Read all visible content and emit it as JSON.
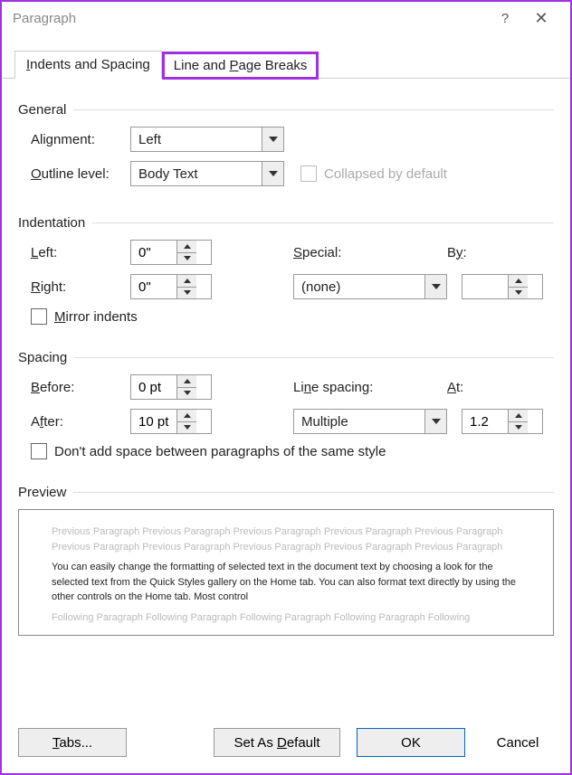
{
  "title": "Paragraph",
  "tabs": {
    "indents": "Indents and Spacing",
    "breaks": "Line and Page Breaks"
  },
  "general": {
    "header": "General",
    "alignment_label": "Alignment:",
    "alignment_value": "Left",
    "outline_label": "Outline level:",
    "outline_value": "Body Text",
    "collapsed_label": "Collapsed by default"
  },
  "indentation": {
    "header": "Indentation",
    "left_label": "Left:",
    "left_value": "0\"",
    "right_label": "Right:",
    "right_value": "0\"",
    "special_label": "Special:",
    "special_value": "(none)",
    "by_label": "By:",
    "by_value": "",
    "mirror_label": "Mirror indents"
  },
  "spacing": {
    "header": "Spacing",
    "before_label": "Before:",
    "before_value": "0 pt",
    "after_label": "After:",
    "after_value": "10 pt",
    "line_spacing_label": "Line spacing:",
    "line_spacing_value": "Multiple",
    "at_label": "At:",
    "at_value": "1.2",
    "dont_add_label": "Don't add space between paragraphs of the same style"
  },
  "preview": {
    "header": "Preview",
    "prev_text": "Previous Paragraph Previous Paragraph Previous Paragraph Previous Paragraph Previous Paragraph Previous Paragraph Previous Paragraph Previous Paragraph Previous Paragraph Previous Paragraph",
    "body_text": "You can easily change the formatting of selected text in the document text by choosing a look for the selected text from the Quick Styles gallery on the Home tab. You can also format text directly by using the other controls on the Home tab. Most control",
    "next_text": "Following Paragraph Following Paragraph Following Paragraph Following Paragraph Following"
  },
  "buttons": {
    "tabs": "Tabs...",
    "default": "Set As Default",
    "ok": "OK",
    "cancel": "Cancel"
  }
}
